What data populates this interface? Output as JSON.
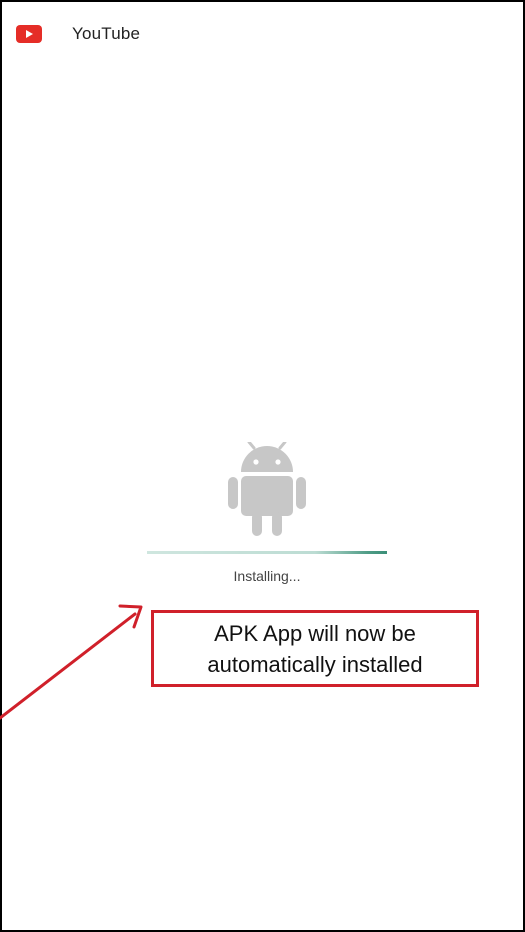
{
  "app": {
    "title": "YouTube",
    "icon": "youtube-logo-icon",
    "brand_color": "#e52d27"
  },
  "installer": {
    "icon": "android-robot-icon",
    "status": "Installing...",
    "progress": 1.0,
    "progress_color": "#3b8f78"
  },
  "annotation": {
    "text": "APK App will now be automatically installed",
    "border_color": "#d0202a",
    "arrow_color": "#d0202a"
  }
}
